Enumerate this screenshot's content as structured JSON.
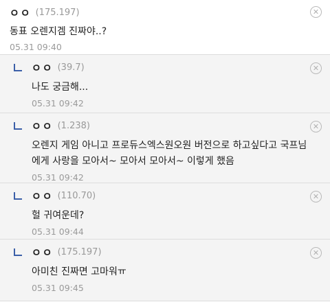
{
  "comments": [
    {
      "nick": "ㅇㅇ",
      "ip": "(175.197)",
      "text": "동표 오렌지겜 진짜야..?",
      "date": "05.31 09:40"
    },
    {
      "nick": "ㅇㅇ",
      "ip": "(39.7)",
      "text": "나도 궁금해...",
      "date": "05.31 09:42"
    },
    {
      "nick": "ㅇㅇ",
      "ip": "(1.238)",
      "text": "오렌지 게임 아니고 프로듀스엑스원오원 버전으로 하고싶다고 국프님에게 사랑을 모아서~ 모아서 모아서~ 이렇게 했음",
      "date": "05.31 09:42"
    },
    {
      "nick": "ㅇㅇ",
      "ip": "(110.70)",
      "text": "헐 귀여운데?",
      "date": "05.31 09:44"
    },
    {
      "nick": "ㅇㅇ",
      "ip": "(175.197)",
      "text": "아미친 진짜면 고마워ㅠ",
      "date": "05.31 09:45"
    }
  ],
  "icons": {
    "delete": "delete-circle-x-icon",
    "reply": "reply-arrow-icon"
  },
  "colors": {
    "reply_bg": "#f4f4f4",
    "reply_mark": "#3b5fa8",
    "meta": "#999999"
  }
}
